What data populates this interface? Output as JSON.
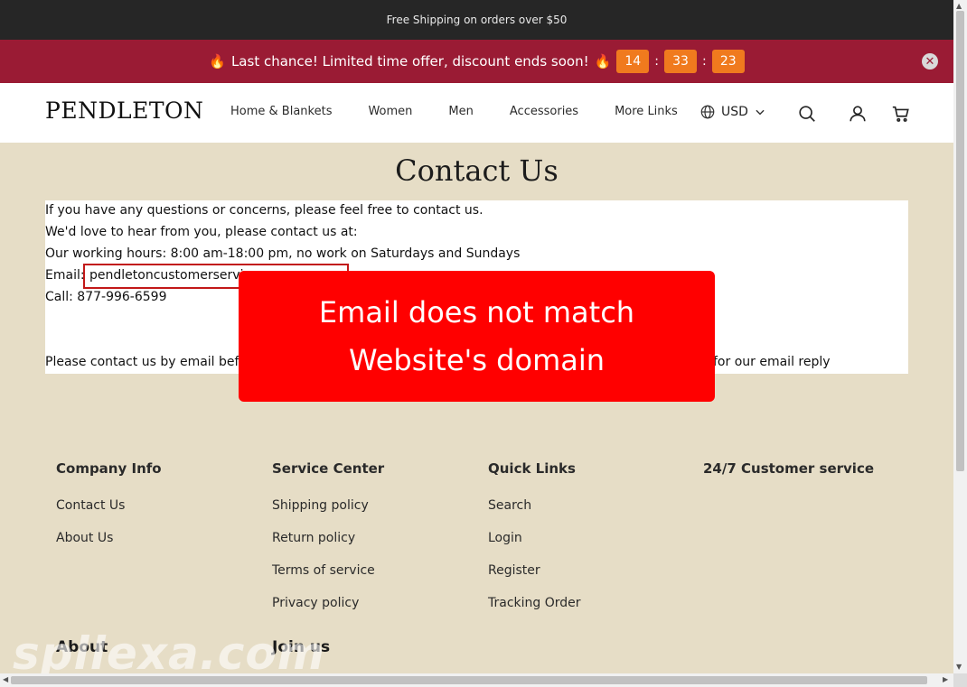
{
  "topbar": {
    "text": "Free Shipping on orders over $50"
  },
  "promo": {
    "flame_icon": "🔥",
    "text": "Last chance! Limited time offer, discount ends soon!",
    "hours": "14",
    "minutes": "33",
    "seconds": "23",
    "separator": ":"
  },
  "header": {
    "logo": "PENDLETON",
    "nav": [
      "Home & Blankets",
      "Women",
      "Men",
      "Accessories",
      "More Links"
    ],
    "currency": "USD"
  },
  "page": {
    "title": "Contact Us",
    "lines": [
      "If you have any questions or concerns, please feel free to contact us.",
      "We'd love to hear from you, please contact us at:",
      "Our working hours: 8:00 am-18:00 pm, no work on Saturdays and Sundays",
      "Email:",
      "pendletoncustomerservic",
      "Call: 877-996-6599",
      "Please contact us by email befor",
      "for our email reply"
    ]
  },
  "warning": {
    "text": "Email does not match Website's domain"
  },
  "footer": {
    "company": {
      "heading": "Company Info",
      "links": [
        "Contact Us",
        "About Us"
      ]
    },
    "service": {
      "heading": "Service Center",
      "links": [
        "Shipping policy",
        "Return policy",
        "Terms of service",
        "Privacy policy"
      ]
    },
    "quick": {
      "heading": "Quick Links",
      "links": [
        "Search",
        "Login",
        "Register",
        "Tracking Order"
      ]
    },
    "support": {
      "heading": "24/7 Customer service"
    },
    "about_heading": "About",
    "join_heading": "Join us"
  },
  "watermark": "spllexa.com",
  "colors": {
    "promo_bg": "#9a1b34",
    "timer_bg": "#f07a1e",
    "warning_bg": "#ff0000",
    "page_bg": "#e6ddc6"
  }
}
